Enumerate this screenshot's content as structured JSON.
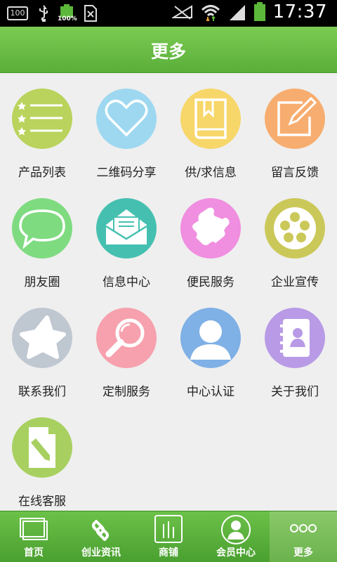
{
  "status_bar": {
    "left_box_text": "100",
    "battery_small_text": "100%",
    "time": "17:37"
  },
  "header": {
    "title": "更多"
  },
  "grid": {
    "items": [
      {
        "label": "产品列表",
        "icon": "list-with-stars-icon",
        "color": "#b9d35c"
      },
      {
        "label": "二维码分享",
        "icon": "heart-outline-icon",
        "color": "#9ed8f0"
      },
      {
        "label": "供/求信息",
        "icon": "bookmark-book-icon",
        "color": "#f7d66a"
      },
      {
        "label": "留言反馈",
        "icon": "edit-note-icon",
        "color": "#f7ad6f"
      },
      {
        "label": "朋友圈",
        "icon": "speech-bubble-icon",
        "color": "#7fdb80"
      },
      {
        "label": "信息中心",
        "icon": "envelope-icon",
        "color": "#45c0b0"
      },
      {
        "label": "便民服务",
        "icon": "puzzle-piece-icon",
        "color": "#f08ee0"
      },
      {
        "label": "企业宣传",
        "icon": "film-reel-icon",
        "color": "#cbc85a"
      },
      {
        "label": "联系我们",
        "icon": "star-icon",
        "color": "#bfc7d1"
      },
      {
        "label": "定制服务",
        "icon": "magnifier-icon",
        "color": "#f6a1ad"
      },
      {
        "label": "中心认证",
        "icon": "user-avatar-icon",
        "color": "#7fb0e6"
      },
      {
        "label": "关于我们",
        "icon": "contact-book-icon",
        "color": "#b89ae6"
      },
      {
        "label": "在线客服",
        "icon": "document-pencil-icon",
        "color": "#a8d060"
      }
    ]
  },
  "tabbar": {
    "tabs": [
      {
        "label": "首页",
        "icon": "home-windows-icon"
      },
      {
        "label": "创业资讯",
        "icon": "chain-link-icon"
      },
      {
        "label": "商铺",
        "icon": "bar-chart-icon"
      },
      {
        "label": "会员中心",
        "icon": "member-avatar-icon"
      },
      {
        "label": "更多",
        "icon": "more-dots-icon"
      }
    ],
    "active_index": 4
  }
}
